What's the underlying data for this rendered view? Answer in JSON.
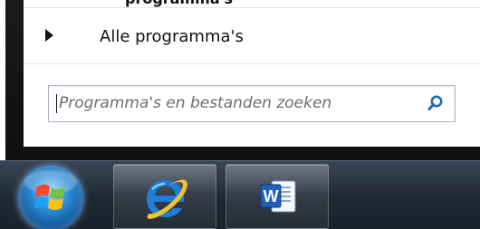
{
  "start_menu": {
    "cut_off_label": "programma's",
    "all_programs_label": "Alle programma's",
    "search": {
      "placeholder": "Programma's en bestanden zoeken",
      "value": ""
    }
  },
  "taskbar": {
    "items": [
      {
        "icon": "windows-start-icon"
      },
      {
        "icon": "internet-explorer-icon"
      },
      {
        "icon": "microsoft-word-icon"
      }
    ]
  },
  "colors": {
    "taskbar_dark": "#1e2833",
    "menu_frame": "#111111",
    "search_border": "#a7b5c6",
    "search_icon": "#1e6bb5",
    "ie_blue": "#1d7fd8",
    "ie_ring": "#f2c230",
    "word_blue": "#1f5fbf"
  }
}
